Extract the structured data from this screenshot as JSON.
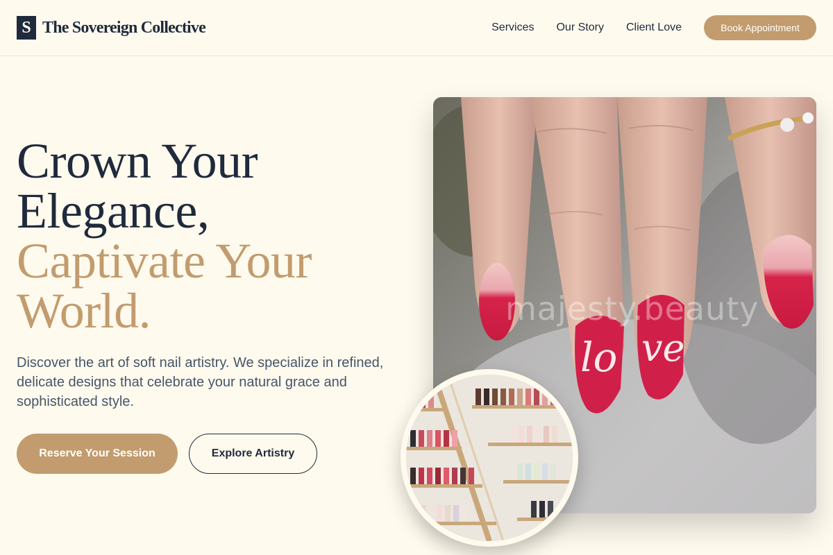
{
  "brand": {
    "mark": "S",
    "name": "The Sovereign Collective"
  },
  "nav": {
    "links": [
      "Services",
      "Our Story",
      "Client Love"
    ],
    "book_label": "Book Appointment"
  },
  "hero": {
    "title_lines": [
      "Crown Your",
      "Elegance,",
      "Captivate Your",
      "World."
    ],
    "description": "Discover the art of soft nail artistry. We specialize in refined, delicate designs that celebrate your natural grace and sophisticated style.",
    "primary_cta": "Reserve Your Session",
    "secondary_cta": "Explore Artistry"
  },
  "images": {
    "main_watermark": "majesty.beauty",
    "main_nail_text": "love",
    "inset_subject": "nail-polish-display-shelves"
  },
  "colors": {
    "background": "#fefaee",
    "navy": "#1f2a3c",
    "gold": "#c29c6e",
    "text_muted": "#475569"
  }
}
